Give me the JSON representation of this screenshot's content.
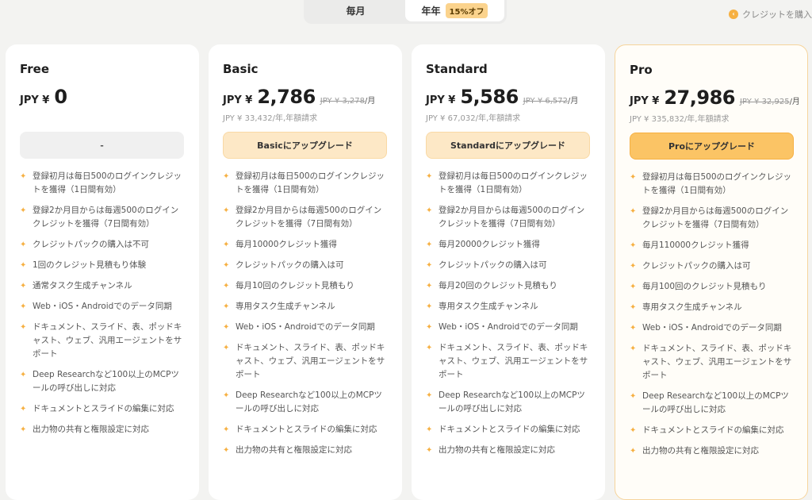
{
  "toggle": {
    "monthly_label": "毎月",
    "yearly_label": "年年",
    "discount_badge": "15%オフ"
  },
  "buy_credits_label": "クレジットを購入",
  "plans": [
    {
      "name": "Free",
      "currency": "JPY ¥",
      "price": "0",
      "old_price": "",
      "per_month": "",
      "annual": "",
      "cta": "-",
      "features": [
        "登録初月は毎日500のログインクレジットを獲得（1日間有効）",
        "登録2か月目からは毎週500のログインクレジットを獲得（7日間有効）",
        "クレジットパックの購入は不可",
        "1回のクレジット見積もり体験",
        "通常タスク生成チャンネル",
        "Web・iOS・Androidでのデータ同期",
        "ドキュメント、スライド、表、ポッドキャスト、ウェブ、汎用エージェントをサポート",
        "Deep Researchなど100以上のMCPツールの呼び出しに対応",
        "ドキュメントとスライドの編集に対応",
        "出力物の共有と権限設定に対応"
      ]
    },
    {
      "name": "Basic",
      "currency": "JPY ¥",
      "price": "2,786",
      "old_price": "JPY ¥ 3,278",
      "per_month": "/月",
      "annual": "JPY ¥ 33,432/年,年額請求",
      "cta": "Basicにアップグレード",
      "features": [
        "登録初月は毎日500のログインクレジットを獲得（1日間有効）",
        "登録2か月目からは毎週500のログインクレジットを獲得（7日間有効）",
        "毎月10000クレジット獲得",
        "クレジットパックの購入は可",
        "毎月10回のクレジット見積もり",
        "専用タスク生成チャンネル",
        "Web・iOS・Androidでのデータ同期",
        "ドキュメント、スライド、表、ポッドキャスト、ウェブ、汎用エージェントをサポート",
        "Deep Researchなど100以上のMCPツールの呼び出しに対応",
        "ドキュメントとスライドの編集に対応",
        "出力物の共有と権限設定に対応"
      ]
    },
    {
      "name": "Standard",
      "currency": "JPY ¥",
      "price": "5,586",
      "old_price": "JPY ¥ 6,572",
      "per_month": "/月",
      "annual": "JPY ¥ 67,032/年,年額請求",
      "cta": "Standardにアップグレード",
      "features": [
        "登録初月は毎日500のログインクレジットを獲得（1日間有効）",
        "登録2か月目からは毎週500のログインクレジットを獲得（7日間有効）",
        "毎月20000クレジット獲得",
        "クレジットパックの購入は可",
        "毎月20回のクレジット見積もり",
        "専用タスク生成チャンネル",
        "Web・iOS・Androidでのデータ同期",
        "ドキュメント、スライド、表、ポッドキャスト、ウェブ、汎用エージェントをサポート",
        "Deep Researchなど100以上のMCPツールの呼び出しに対応",
        "ドキュメントとスライドの編集に対応",
        "出力物の共有と権限設定に対応"
      ]
    },
    {
      "name": "Pro",
      "currency": "JPY ¥",
      "price": "27,986",
      "old_price": "JPY ¥ 32,925",
      "per_month": "/月",
      "annual": "JPY ¥ 335,832/年,年額請求",
      "cta": "Proにアップグレード",
      "features": [
        "登録初月は毎日500のログインクレジットを獲得（1日間有効）",
        "登録2か月目からは毎週500のログインクレジットを獲得（7日間有効）",
        "毎月110000クレジット獲得",
        "クレジットパックの購入は可",
        "毎月100回のクレジット見積もり",
        "専用タスク生成チャンネル",
        "Web・iOS・Androidでのデータ同期",
        "ドキュメント、スライド、表、ポッドキャスト、ウェブ、汎用エージェントをサポート",
        "Deep Researchなど100以上のMCPツールの呼び出しに対応",
        "ドキュメントとスライドの編集に対応",
        "出力物の共有と権限設定に対応"
      ]
    }
  ]
}
